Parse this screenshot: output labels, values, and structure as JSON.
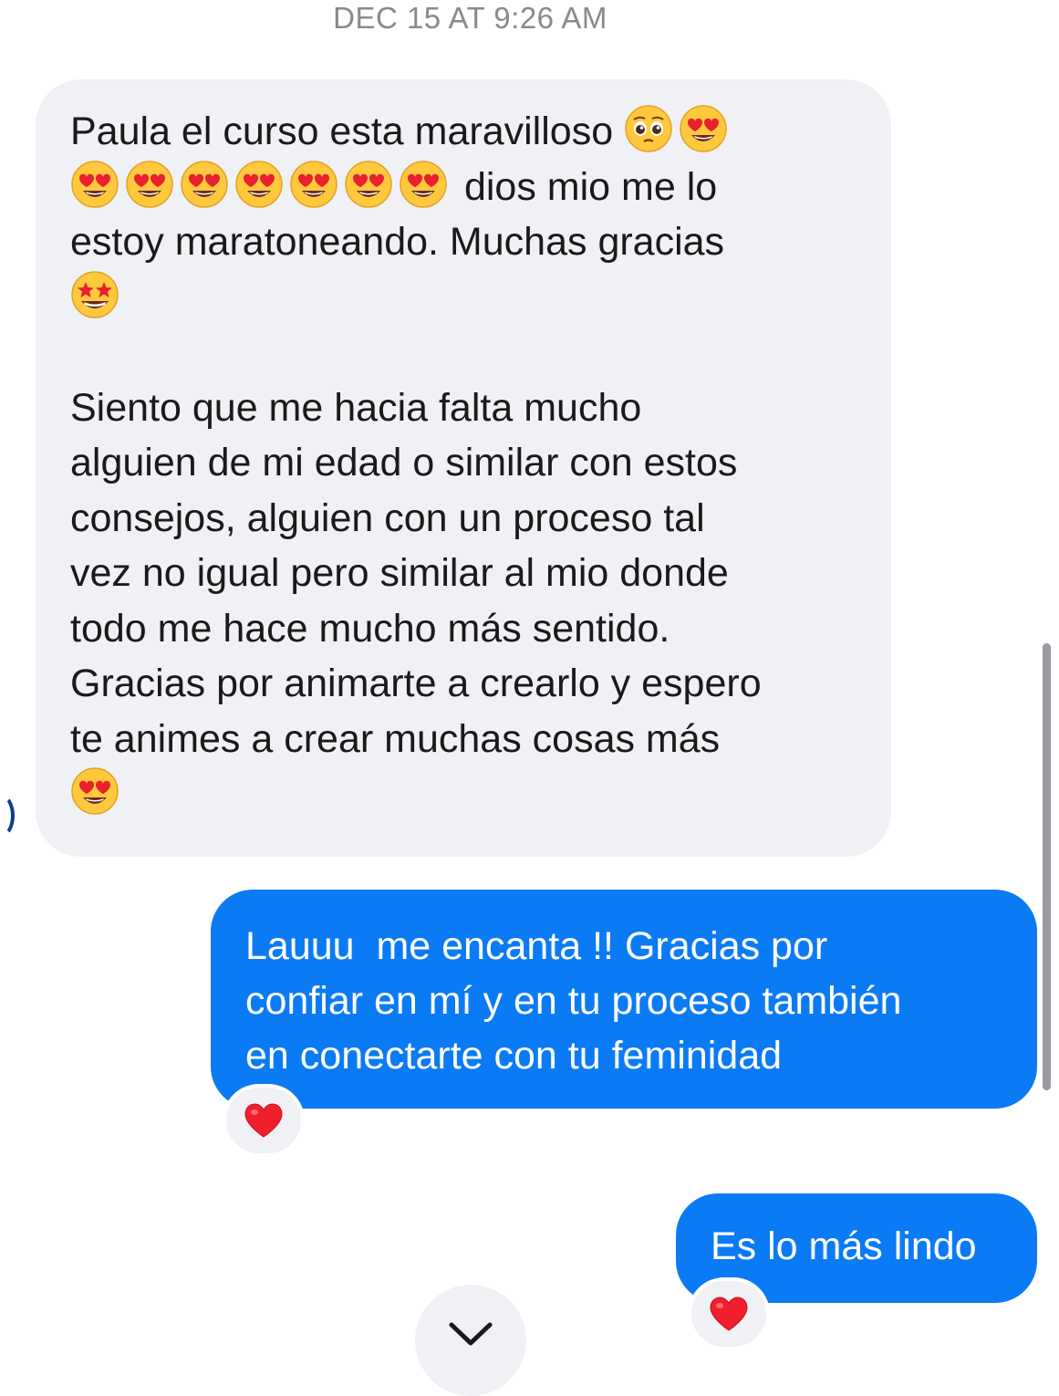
{
  "timestamp": "DEC 15 AT 9:26 AM",
  "incoming_message": {
    "line1_text": "Paula el curso esta maravilloso ",
    "line1_emojis": [
      "pleading-face-emoji",
      "heart-eyes-emoji"
    ],
    "line2_emojis": [
      "heart-eyes-emoji",
      "heart-eyes-emoji",
      "heart-eyes-emoji",
      "heart-eyes-emoji",
      "heart-eyes-emoji",
      "heart-eyes-emoji",
      "heart-eyes-emoji"
    ],
    "line2_text": " dios mio me lo",
    "line3_text": "estoy maratoneando. Muchas gracias",
    "line4_emoji": "star-struck-emoji",
    "paragraph2": "Siento que me hacia falta mucho\nalguien de mi edad o similar con estos\nconsejos, alguien con un proceso tal\nvez no igual pero similar al mio donde\ntodo me hace mucho más sentido.\nGracias por animarte a crearlo y espero\nte animes a crear muchas cosas más",
    "final_emoji": "heart-eyes-emoji"
  },
  "outgoing_messages": [
    {
      "text": "Lauuu  me encanta !! Gracias por\nconfiar en mí y en tu proceso también\nen conectarte con tu feminidad",
      "reaction": "red-heart-emoji"
    },
    {
      "text": "Es lo más lindo",
      "reaction": "red-heart-emoji"
    }
  ],
  "colors": {
    "incoming_bubble": "#f0f1f4",
    "outgoing_bubble": "#0b7bf5",
    "timestamp": "#8a8a8e"
  },
  "scroll_button_icon": "chevron-down-icon"
}
